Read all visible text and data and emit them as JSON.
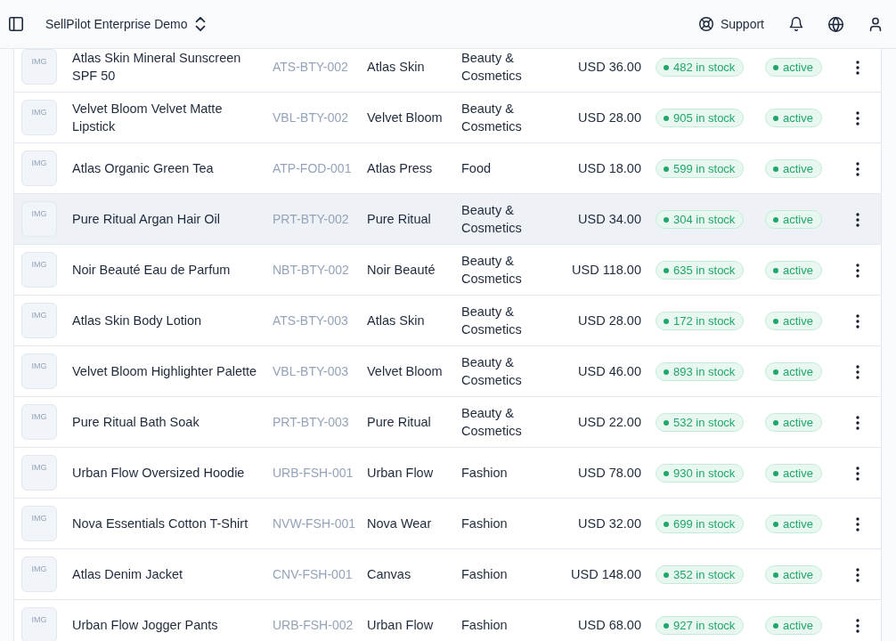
{
  "header": {
    "workspace": "SellPilot Enterprise Demo",
    "support": "Support"
  },
  "products": {
    "rows": [
      {
        "image": "IMG",
        "name": "Atlas Skin Mineral Sunscreen SPF 50",
        "sku": "ATS-BTY-002",
        "brand": "Atlas Skin",
        "category": "Beauty & Cosmetics",
        "price": "USD 36.00",
        "stock": "482 in stock",
        "status": "active",
        "highlighted": false
      },
      {
        "image": "IMG",
        "name": "Velvet Bloom Velvet Matte Lipstick",
        "sku": "VBL-BTY-002",
        "brand": "Velvet Bloom",
        "category": "Beauty & Cosmetics",
        "price": "USD 28.00",
        "stock": "905 in stock",
        "status": "active",
        "highlighted": false
      },
      {
        "image": "IMG",
        "name": "Atlas Organic Green Tea",
        "sku": "ATP-FOD-001",
        "brand": "Atlas Press",
        "category": "Food",
        "price": "USD 18.00",
        "stock": "599 in stock",
        "status": "active",
        "highlighted": false
      },
      {
        "image": "IMG",
        "name": "Pure Ritual Argan Hair Oil",
        "sku": "PRT-BTY-002",
        "brand": "Pure Ritual",
        "category": "Beauty & Cosmetics",
        "price": "USD 34.00",
        "stock": "304 in stock",
        "status": "active",
        "highlighted": true
      },
      {
        "image": "IMG",
        "name": "Noir Beauté Eau de Parfum",
        "sku": "NBT-BTY-002",
        "brand": "Noir Beauté",
        "category": "Beauty & Cosmetics",
        "price": "USD 118.00",
        "stock": "635 in stock",
        "status": "active",
        "highlighted": false
      },
      {
        "image": "IMG",
        "name": "Atlas Skin Body Lotion",
        "sku": "ATS-BTY-003",
        "brand": "Atlas Skin",
        "category": "Beauty & Cosmetics",
        "price": "USD 28.00",
        "stock": "172 in stock",
        "status": "active",
        "highlighted": false
      },
      {
        "image": "IMG",
        "name": "Velvet Bloom Highlighter Palette",
        "sku": "VBL-BTY-003",
        "brand": "Velvet Bloom",
        "category": "Beauty & Cosmetics",
        "price": "USD 46.00",
        "stock": "893 in stock",
        "status": "active",
        "highlighted": false
      },
      {
        "image": "IMG",
        "name": "Pure Ritual Bath Soak",
        "sku": "PRT-BTY-003",
        "brand": "Pure Ritual",
        "category": "Beauty & Cosmetics",
        "price": "USD 22.00",
        "stock": "532 in stock",
        "status": "active",
        "highlighted": false
      },
      {
        "image": "IMG",
        "name": "Urban Flow Oversized Hoodie",
        "sku": "URB-FSH-001",
        "brand": "Urban Flow",
        "category": "Fashion",
        "price": "USD 78.00",
        "stock": "930 in stock",
        "status": "active",
        "highlighted": false
      },
      {
        "image": "IMG",
        "name": "Nova Essentials Cotton T-Shirt",
        "sku": "NVW-FSH-001",
        "brand": "Nova Wear",
        "category": "Fashion",
        "price": "USD 32.00",
        "stock": "699 in stock",
        "status": "active",
        "highlighted": false
      },
      {
        "image": "IMG",
        "name": "Atlas Denim Jacket",
        "sku": "CNV-FSH-001",
        "brand": "Canvas",
        "category": "Fashion",
        "price": "USD 148.00",
        "stock": "352 in stock",
        "status": "active",
        "highlighted": false
      },
      {
        "image": "IMG",
        "name": "Urban Flow Jogger Pants",
        "sku": "URB-FSH-002",
        "brand": "Urban Flow",
        "category": "Fashion",
        "price": "USD 68.00",
        "stock": "927 in stock",
        "status": "active",
        "highlighted": false
      }
    ]
  }
}
